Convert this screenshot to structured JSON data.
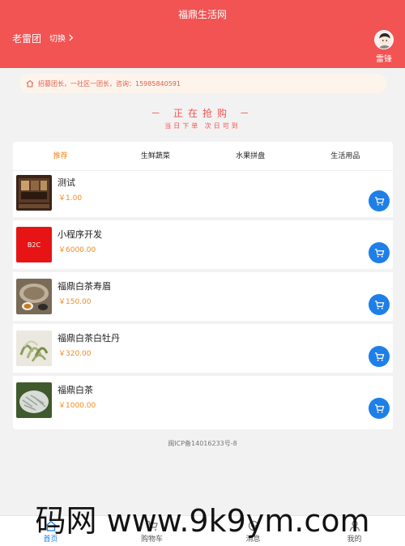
{
  "header": {
    "title": "福鼎生活网",
    "leader_name": "老雷团",
    "switch_label": "切换",
    "user_name": "雷锋"
  },
  "notice": {
    "text": "招募团长，一社区一团长，咨询：15985840591",
    "icon": "home-icon"
  },
  "rush": {
    "title": "－ 正在抢购 －",
    "subtitle": "当日下单 次日可到"
  },
  "tabs": [
    {
      "label": "推荐",
      "active": true
    },
    {
      "label": "生鲜蔬菜",
      "active": false
    },
    {
      "label": "水果拼盘",
      "active": false
    },
    {
      "label": "生活用品",
      "active": false
    }
  ],
  "products": [
    {
      "name": "测试",
      "price": "￥1.00",
      "thumb": "tea-set"
    },
    {
      "name": "小程序开发",
      "price": "￥6000.00",
      "thumb": "b2c",
      "thumb_text": "B2C"
    },
    {
      "name": "福鼎白茶寿眉",
      "price": "￥150.00",
      "thumb": "tea-cake"
    },
    {
      "name": "福鼎白茶白牡丹",
      "price": "￥320.00",
      "thumb": "tea-leaves"
    },
    {
      "name": "福鼎白茶",
      "price": "￥1000.00",
      "thumb": "tea-silver"
    }
  ],
  "footer": {
    "icp": "闽ICP备14016233号-8"
  },
  "tabbar": [
    {
      "label": "首页",
      "icon": "home-icon",
      "active": true
    },
    {
      "label": "购物车",
      "icon": "cart-icon",
      "active": false
    },
    {
      "label": "消息",
      "icon": "message-icon",
      "active": false
    },
    {
      "label": "我的",
      "icon": "user-icon",
      "active": false
    }
  ],
  "watermark": {
    "text": "码网 www.9k9ym.com"
  },
  "colors": {
    "header_bg": "#f25353",
    "accent_orange": "#f08a1e",
    "cart_blue": "#1e7fe8"
  }
}
